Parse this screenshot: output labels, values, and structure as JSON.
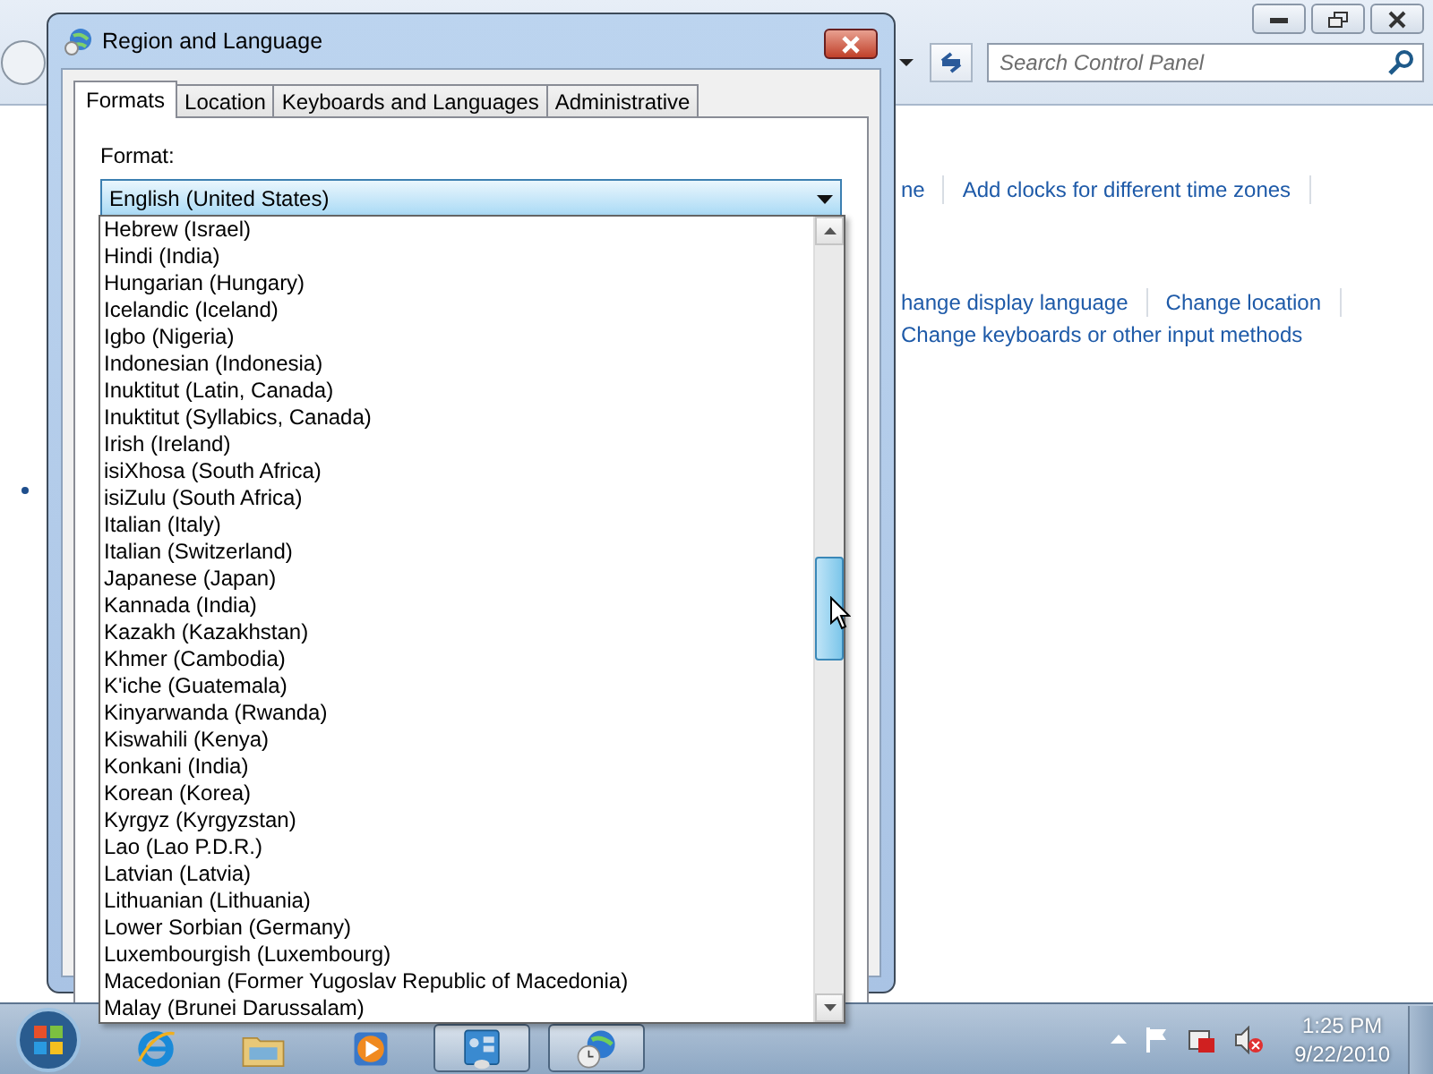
{
  "control_panel": {
    "search": {
      "placeholder": "Search Control Panel"
    },
    "link_rows": [
      {
        "links": [
          "ne",
          "Add clocks for different time zones"
        ]
      },
      {
        "links": [
          "hange display language",
          "Change location"
        ]
      },
      {
        "links": [
          "Change keyboards or other input methods"
        ]
      }
    ]
  },
  "dialog": {
    "title": "Region and Language",
    "tabs": [
      {
        "label": "Formats",
        "selected": true
      },
      {
        "label": "Location",
        "selected": false
      },
      {
        "label": "Keyboards and Languages",
        "selected": false
      },
      {
        "label": "Administrative",
        "selected": false
      }
    ],
    "format_label": "Format:",
    "format_combo": {
      "value": "English (United States)",
      "expanded": true
    },
    "dropdown_items": [
      {
        "label": "Hebrew (Israel)",
        "selected": false
      },
      {
        "label": "Hindi (India)",
        "selected": false
      },
      {
        "label": "Hungarian (Hungary)",
        "selected": false
      },
      {
        "label": "Icelandic (Iceland)",
        "selected": false
      },
      {
        "label": "Igbo (Nigeria)",
        "selected": false
      },
      {
        "label": "Indonesian (Indonesia)",
        "selected": false
      },
      {
        "label": "Inuktitut (Latin, Canada)",
        "selected": false
      },
      {
        "label": "Inuktitut (Syllabics, Canada)",
        "selected": false
      },
      {
        "label": "Irish (Ireland)",
        "selected": false
      },
      {
        "label": "isiXhosa (South Africa)",
        "selected": false
      },
      {
        "label": "isiZulu (South Africa)",
        "selected": false
      },
      {
        "label": "Italian (Italy)",
        "selected": false
      },
      {
        "label": "Italian (Switzerland)",
        "selected": false
      },
      {
        "label": "Japanese (Japan)",
        "selected": false
      },
      {
        "label": "Kannada (India)",
        "selected": false
      },
      {
        "label": "Kazakh (Kazakhstan)",
        "selected": false
      },
      {
        "label": "Khmer (Cambodia)",
        "selected": false
      },
      {
        "label": "K'iche (Guatemala)",
        "selected": false
      },
      {
        "label": "Kinyarwanda (Rwanda)",
        "selected": false
      },
      {
        "label": "Kiswahili (Kenya)",
        "selected": false
      },
      {
        "label": "Konkani (India)",
        "selected": false
      },
      {
        "label": "Korean (Korea)",
        "selected": false
      },
      {
        "label": "Kyrgyz (Kyrgyzstan)",
        "selected": false
      },
      {
        "label": "Lao (Lao P.D.R.)",
        "selected": false
      },
      {
        "label": "Latvian (Latvia)",
        "selected": false
      },
      {
        "label": "Lithuanian (Lithuania)",
        "selected": false
      },
      {
        "label": "Lower Sorbian (Germany)",
        "selected": false
      },
      {
        "label": "Luxembourgish (Luxembourg)",
        "selected": false
      },
      {
        "label": "Macedonian (Former Yugoslav Republic of Macedonia)",
        "selected": false
      },
      {
        "label": "Malay (Brunei Darussalam)",
        "selected": false
      }
    ]
  },
  "taskbar": {
    "buttons": [
      {
        "kind": "browser",
        "active": false
      },
      {
        "kind": "folder",
        "active": false
      },
      {
        "kind": "player",
        "active": false
      },
      {
        "kind": "panel",
        "active": true
      },
      {
        "kind": "globe",
        "active": true
      }
    ],
    "clock": {
      "time": "1:25 PM",
      "date": "9/22/2010"
    }
  }
}
